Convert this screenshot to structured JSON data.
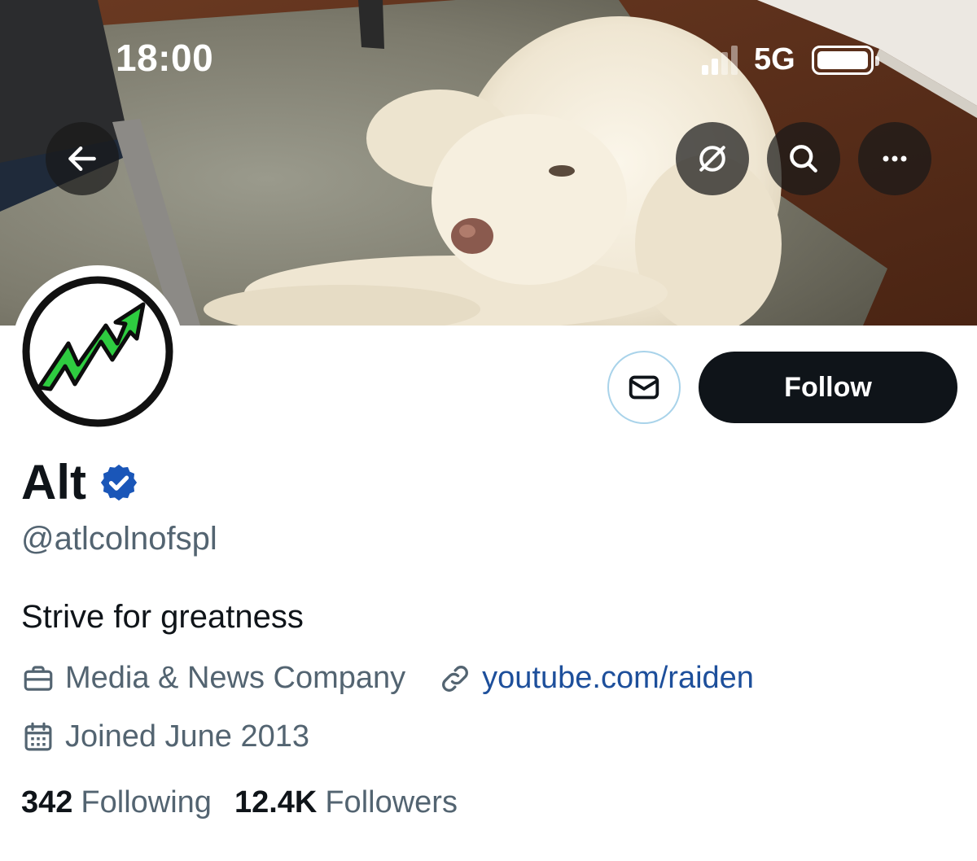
{
  "status_bar": {
    "time": "18:00",
    "network": "5G",
    "signal_bars_active": 2,
    "signal_bars_total": 4
  },
  "header_actions": {
    "back_icon": "arrow-left-icon",
    "translate_icon": "globe-slash-icon",
    "search_icon": "search-icon",
    "more_icon": "more-dots-icon"
  },
  "profile": {
    "avatar_icon": "trending-up-arrow-logo",
    "display_name": "Alt",
    "verified_icon": "verified-badge-icon",
    "handle": "@atlcolnofspl",
    "bio": "Strive for greatness",
    "category": "Media & News Company",
    "website": "youtube.com/raiden",
    "joined": "Joined June 2013",
    "following_count": "342",
    "following_label": "Following",
    "followers_count": "12.4K",
    "followers_label": "Followers"
  },
  "actions": {
    "message_icon": "envelope-icon",
    "follow_label": "Follow"
  },
  "colors": {
    "follow_button_bg": "#0f1419",
    "verified_badge": "#1a56b8",
    "link": "#1d4f9b",
    "secondary_text": "#536471",
    "avatar_arrow": "#22c55e"
  }
}
